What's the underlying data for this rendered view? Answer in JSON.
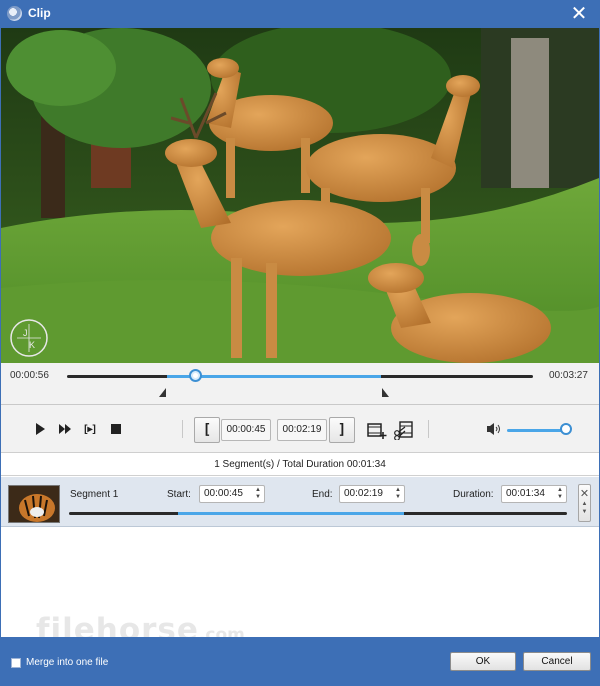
{
  "window": {
    "title": "Clip",
    "close_icon": "close-icon",
    "app_icon": "app-icon"
  },
  "player": {
    "current_time": "00:00:56",
    "total_time": "00:03:27",
    "play_icon": "play-icon",
    "fast_forward_icon": "fast-forward-icon",
    "step_icon_label": "[▸]",
    "stop_icon": "stop-icon",
    "set_start_label": "[",
    "start_time": "00:00:45",
    "end_time": "00:02:19",
    "set_end_label": "]",
    "new_clip_icon": "film-plus-icon",
    "split_icon": "scissors-film-icon",
    "volume_icon": "speaker-icon",
    "volume_level": 0.95,
    "progress_fraction": 0.27
  },
  "summary": {
    "text": "1 Segment(s) / Total Duration 00:01:34"
  },
  "segments": [
    {
      "name": "Segment 1",
      "start_label": "Start:",
      "start": "00:00:45",
      "end_label": "End:",
      "end": "00:02:19",
      "duration_label": "Duration:",
      "duration": "00:01:34"
    }
  ],
  "watermark": {
    "brand": "filehorse",
    "suffix": ".com",
    "logo_letters": "J K"
  },
  "footer": {
    "merge_label": "Merge into one file",
    "merge_checked": false,
    "ok_label": "OK",
    "cancel_label": "Cancel"
  }
}
